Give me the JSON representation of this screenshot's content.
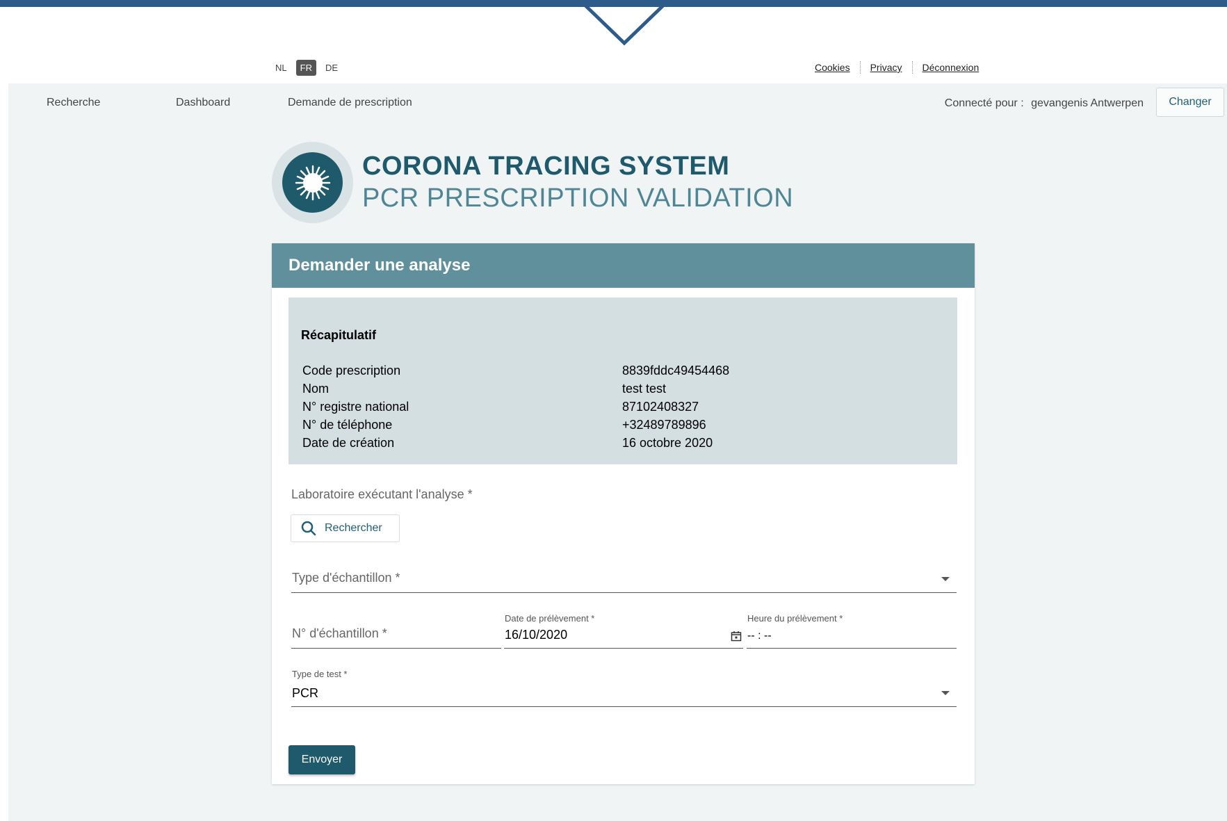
{
  "languages": [
    {
      "code": "NL",
      "active": false
    },
    {
      "code": "FR",
      "active": true
    },
    {
      "code": "DE",
      "active": false
    }
  ],
  "top_links": [
    "Cookies",
    "Privacy",
    "Déconnexion"
  ],
  "nav": {
    "items": [
      "Recherche",
      "Dashboard",
      "Demande de prescription"
    ],
    "connected_label": "Connecté pour :",
    "connected_org": "gevangenis Antwerpen",
    "change_button": "Changer"
  },
  "header": {
    "title": "CORONA TRACING SYSTEM",
    "subtitle": "PCR PRESCRIPTION VALIDATION"
  },
  "card": {
    "title": "Demander une analyse",
    "recap": {
      "heading": "Récapitulatif",
      "rows": [
        {
          "label": "Code prescription",
          "value": "8839fddc49454468"
        },
        {
          "label": "Nom",
          "value": "test test"
        },
        {
          "label": "N° registre national",
          "value": "87102408327"
        },
        {
          "label": "N° de téléphone",
          "value": "+32489789896"
        },
        {
          "label": "Date de création",
          "value": "16 octobre 2020"
        }
      ]
    },
    "lab_label": "Laboratoire exécutant l'analyse *",
    "search_button": "Rechercher",
    "sample_type_placeholder": "Type d'échantillon *",
    "sample_number_placeholder": "N° d'échantillon *",
    "collection_date_label": "Date de prélèvement *",
    "collection_date_value": "16/10/2020",
    "collection_time_label": "Heure du prélèvement *",
    "collection_time_value": "-- : --",
    "test_type_label": "Type de test *",
    "test_type_value": "PCR",
    "submit_button": "Envoyer"
  },
  "colors": {
    "brand_dark": "#1e5a6b",
    "brand_mid": "#5f909b",
    "recap_bg": "#d4dfe2",
    "topbar": "#2e5c8a"
  }
}
